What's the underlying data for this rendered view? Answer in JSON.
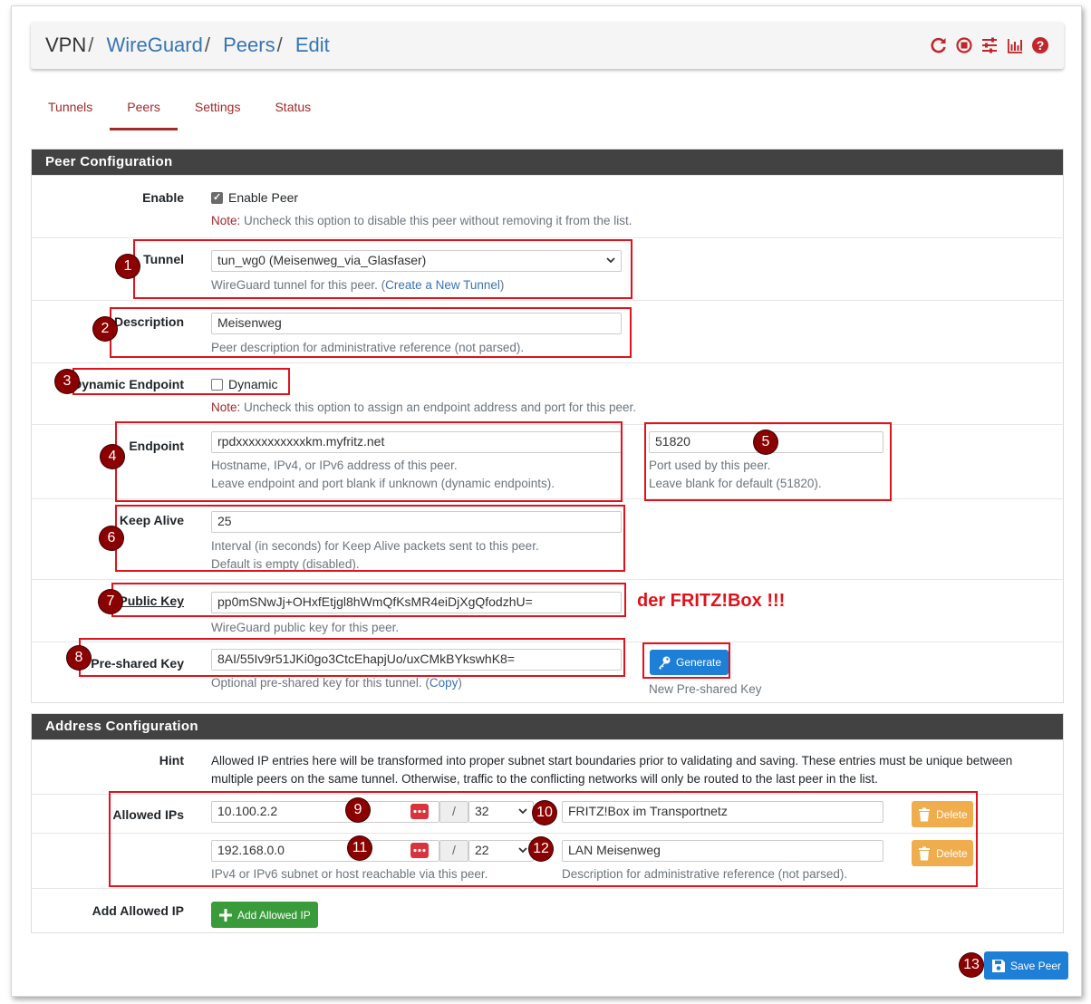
{
  "breadcrumb": {
    "root": "VPN",
    "sep": "/",
    "items": [
      "WireGuard",
      "Peers",
      "Edit"
    ]
  },
  "header_icons": [
    "reload-icon",
    "stop-circle-icon",
    "sliders-icon",
    "bar-chart-icon",
    "help-icon"
  ],
  "tabs": [
    {
      "label": "Tunnels",
      "active": false
    },
    {
      "label": "Peers",
      "active": true
    },
    {
      "label": "Settings",
      "active": false
    },
    {
      "label": "Status",
      "active": false
    }
  ],
  "peer_config": {
    "title": "Peer Configuration",
    "enable": {
      "label": "Enable",
      "checkbox_label": "Enable Peer",
      "checked": true,
      "note_prefix": "Note:",
      "note": " Uncheck this option to disable this peer without removing it from the list."
    },
    "tunnel": {
      "label": "Tunnel",
      "value": "tun_wg0 (Meisenweg_via_Glasfaser)",
      "help_prefix": "WireGuard tunnel for this peer. (",
      "help_link": "Create a New Tunnel",
      "help_suffix": ")"
    },
    "description": {
      "label": "Description",
      "value": "Meisenweg",
      "help": "Peer description for administrative reference (not parsed)."
    },
    "dynamic": {
      "label": "Dynamic Endpoint",
      "checkbox_label": "Dynamic",
      "checked": false,
      "note_prefix": "Note:",
      "note": " Uncheck this option to assign an endpoint address and port for this peer."
    },
    "endpoint": {
      "label": "Endpoint",
      "value": "rpdxxxxxxxxxxxkm.myfritz.net",
      "help1": "Hostname, IPv4, or IPv6 address of this peer.",
      "help2": "Leave endpoint and port blank if unknown (dynamic endpoints).",
      "port_value": "51820",
      "port_help1": "Port used by this peer.",
      "port_help2": "Leave blank for default (51820)."
    },
    "keepalive": {
      "label": "Keep Alive",
      "value": "25",
      "help1": "Interval (in seconds) for Keep Alive packets sent to this peer.",
      "help2": "Default is empty (disabled)."
    },
    "public_key": {
      "label": "Public Key",
      "value": "pp0mSNwJj+OHxfEtjgl8hWmQfKsMR4eiDjXgQfodzhU=",
      "help": "WireGuard public key for this peer.",
      "annotation": "der FRITZ!Box !!!"
    },
    "psk": {
      "label": "Pre-shared Key",
      "value": "8AI/55Iv9r51JKi0go3CtcEhapjUo/uxCMkBYkswhK8=",
      "help_prefix": "Optional pre-shared key for this tunnel. (",
      "help_link": "Copy",
      "help_suffix": ")",
      "generate_label": "Generate",
      "generate_help": "New Pre-shared Key"
    }
  },
  "address_config": {
    "title": "Address Configuration",
    "hint_label": "Hint",
    "hint": "Allowed IP entries here will be transformed into proper subnet start boundaries prior to validating and saving. These entries must be unique between multiple peers on the same tunnel. Otherwise, traffic to the conflicting networks will only be routed to the last peer in the list.",
    "allowed_label": "Allowed IPs",
    "slash": "/",
    "rows": [
      {
        "ip": "10.100.2.2",
        "mask": "32",
        "descr": "FRITZ!Box im Transportnetz",
        "delete": "Delete"
      },
      {
        "ip": "192.168.0.0",
        "mask": "22",
        "descr": "LAN Meisenweg",
        "delete": "Delete"
      }
    ],
    "ip_help": "IPv4 or IPv6 subnet or host reachable via this peer.",
    "descr_help": "Description for administrative reference (not parsed).",
    "add_label": "Add Allowed IP",
    "add_button": "Add Allowed IP"
  },
  "save_button": "Save Peer",
  "badges": [
    "1",
    "2",
    "3",
    "4",
    "5",
    "6",
    "7",
    "8",
    "9",
    "10",
    "11",
    "12",
    "13"
  ],
  "colors": {
    "accent": "#a12a2a",
    "link": "#3874b4",
    "annotation": "#e0121b",
    "badge": "#8b0000"
  }
}
